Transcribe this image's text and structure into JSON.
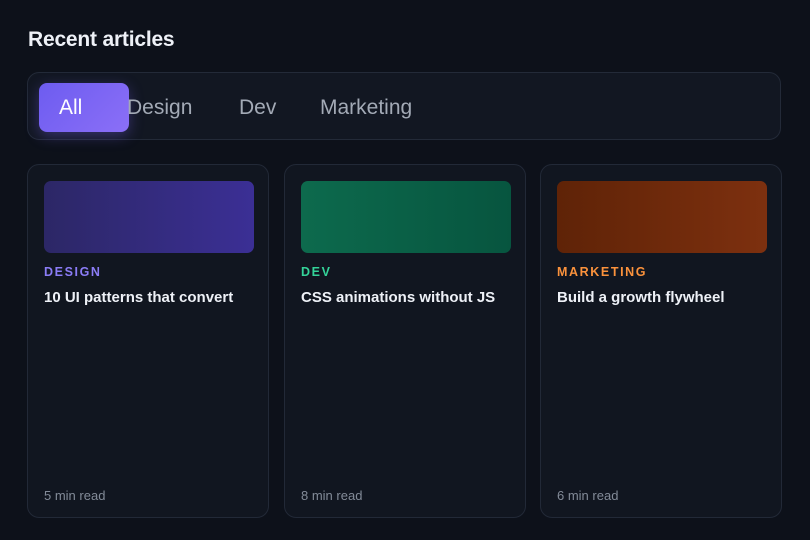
{
  "section": {
    "title": "Recent articles"
  },
  "tabs": [
    {
      "label": "All",
      "active": true
    },
    {
      "label": "Design",
      "active": false
    },
    {
      "label": "Dev",
      "active": false
    },
    {
      "label": "Marketing",
      "active": false
    }
  ],
  "articles": [
    {
      "tag": "DESIGN",
      "title": "10 UI patterns that convert",
      "read_time": "5 min read",
      "tag_color": "#8b7cf6"
    },
    {
      "tag": "DEV",
      "title": "CSS animations without JS",
      "read_time": "8 min read",
      "tag_color": "#34d399"
    },
    {
      "tag": "MARKETING",
      "title": "Build a growth flywheel",
      "read_time": "6 min read",
      "tag_color": "#fb923c"
    }
  ],
  "colors": {
    "background": "#0d111a",
    "card": "#111620",
    "accent": "#7563f3"
  }
}
